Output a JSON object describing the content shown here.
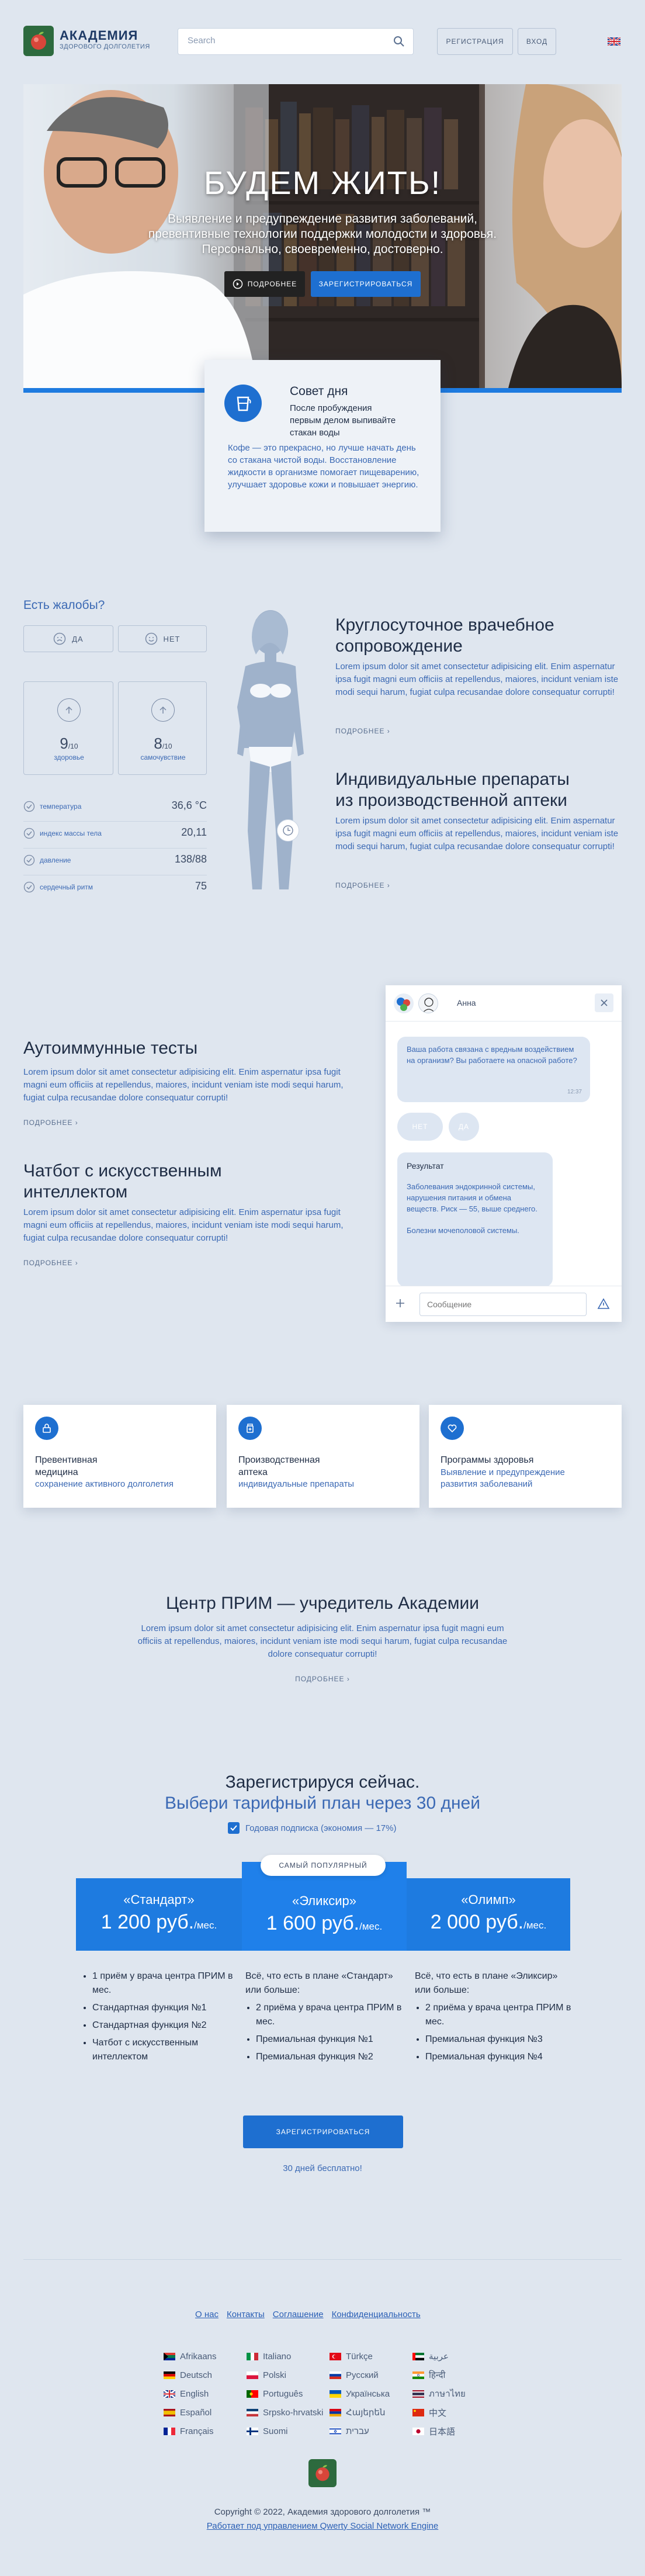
{
  "header": {
    "logo_title": "АКАДЕМИЯ",
    "logo_sub": "ЗДОРОВОГО ДОЛГОЛЕТИЯ",
    "search_placeholder": "Search",
    "register_label": "РЕГИСТРАЦИЯ",
    "login_label": "ВХОД"
  },
  "hero": {
    "title": "БУДЕМ ЖИТЬ!",
    "subtitle_1": "Выявление и предупреждение развития заболеваний,",
    "subtitle_2": "превентивные технологии поддержки молодости и здоровья.",
    "subtitle_3": "Персонально, своевременно, достоверно.",
    "more_label": "ПОДРОБНЕЕ",
    "register_label": "ЗАРЕГИСТРИРОВАТЬСЯ"
  },
  "tip": {
    "title": "Совет дня",
    "lead": "После пробуждения первым делом выпивайте стакан воды",
    "body": "Кофе — это прекрасно, но лучше начать день со стакана чистой воды. Восстановление жидкости в организме помогает пищеварению, улучшает здоровье кожи и повышает энергию."
  },
  "complaints": {
    "title": "Есть жалобы?",
    "yes": "ДА",
    "no": "НЕТ",
    "vitals_big": [
      {
        "value": "9",
        "unit": "/10",
        "label": "здоровье"
      },
      {
        "value": "8",
        "unit": "/10",
        "label": "самочувствие"
      }
    ],
    "rows": [
      {
        "label": "температура",
        "value": "36,6 °C"
      },
      {
        "label": "индекс массы тела",
        "value": "20,11"
      },
      {
        "label": "давление",
        "value": "138/88"
      },
      {
        "label": "сердечный ритм",
        "value": "75"
      }
    ]
  },
  "services": [
    {
      "title_1": "Круглосуточное врачебное",
      "title_2": "сопровождение",
      "text": "Lorem ipsum dolor sit amet consectetur adipisicing elit. Enim aspernatur ipsa fugit magni eum officiis at repellendus, maiores, incidunt veniam iste modi sequi harum, fugiat culpa recusandae dolore consequatur corrupti!",
      "more": "ПОДРОБНЕЕ"
    },
    {
      "title_1": "Индивидуальные препараты",
      "title_2": "из производственной аптеки",
      "text": "Lorem ipsum dolor sit amet consectetur adipisicing elit. Enim aspernatur ipsa fugit magni eum officiis at repellendus, maiores, incidunt veniam iste modi sequi harum, fugiat culpa recusandae dolore consequatur corrupti!",
      "more": "ПОДРОБНЕЕ"
    },
    {
      "title_1": "Аутоиммунные тесты",
      "title_2": "",
      "text": "Lorem ipsum dolor sit amet consectetur adipisicing elit. Enim aspernatur ipsa fugit magni eum officiis at repellendus, maiores, incidunt veniam iste modi sequi harum, fugiat culpa recusandae dolore consequatur corrupti!",
      "more": "ПОДРОБНЕЕ"
    },
    {
      "title_1": "Чатбот с искусственным",
      "title_2": "интеллектом",
      "text": "Lorem ipsum dolor sit amet consectetur adipisicing elit. Enim aspernatur ipsa fugit magni eum officiis at repellendus, maiores, incidunt veniam iste modi sequi harum, fugiat culpa recusandae dolore consequatur corrupti!",
      "more": "ПОДРОБНЕЕ"
    }
  ],
  "chat": {
    "name": "Анна",
    "question": "Ваша работа связана с вредным воздействием на организм? Вы работаете на опасной работе?",
    "time": "12:37",
    "answer_no": "НЕТ",
    "answer_yes": "ДА",
    "result_title": "Результат",
    "result_text": "Заболевания эндокринной системы, нарушения питания и обмена веществ. Риск — 55, выше среднего.",
    "result_extra": "Болезни мочеполовой системы.",
    "input_placeholder": "Сообщение"
  },
  "features": [
    {
      "title_1": "Превентивная",
      "title_2": "медицина",
      "sub_1": "сохранение активного долголетия",
      "sub_2": ""
    },
    {
      "title_1": "Производственная",
      "title_2": "аптека",
      "sub_1": "индивидуальные препараты",
      "sub_2": ""
    },
    {
      "title_1": "Программы здоровья",
      "title_2": "",
      "sub_1": "Выявление и предупреждение",
      "sub_2": "развития заболеваний"
    }
  ],
  "center": {
    "title": "Центр ПРИМ — учредитель Академии",
    "text": "Lorem ipsum dolor sit amet consectetur adipisicing elit. Enim aspernatur ipsa fugit magni eum officiis at repellendus, maiores, incidunt veniam iste modi sequi harum, fugiat culpa recusandae dolore consequatur corrupti!",
    "more": "ПОДРОБНЕЕ"
  },
  "pricing": {
    "title_1": "Зарегистрируся сейчас.",
    "title_2": "Выбери тарифный план через 30 дней",
    "annual_label": "Годовая подписка (экономия — 17%)",
    "popular_label": "САМЫЙ ПОПУЛЯРНЫЙ",
    "plans": [
      {
        "name": "«Стандарт»",
        "price": "1 200 руб.",
        "per": "/мес."
      },
      {
        "name": "«Эликсир»",
        "price": "1 600 руб.",
        "per": "/мес."
      },
      {
        "name": "«Олимп»",
        "price": "2 000 руб.",
        "per": "/мес."
      }
    ],
    "col1": [
      "1 приём у врача центра ПРИМ в мес.",
      "Стандартная функция №1",
      "Стандартная функция №2",
      "Чатбот с искусственным интеллектом"
    ],
    "col2_intro": "Всё, что есть в плане «Стандарт» или больше:",
    "col2": [
      "2 приёма у врача центра ПРИМ в мес.",
      "Премиальная функция №1",
      "Премиальная функция №2"
    ],
    "col3_intro": "Всё, что есть в плане «Эликсир» или больше:",
    "col3": [
      "2 приёма у врача центра ПРИМ в мес.",
      "Премиальная функция №3",
      "Премиальная функция №4"
    ],
    "register_label": "ЗАРЕГИСТРИРОВАТЬСЯ",
    "free_label": "30 дней бесплатно!"
  },
  "footer": {
    "links": [
      "О нас",
      "Контакты",
      "Соглашение",
      "Конфиденциальность"
    ],
    "languages": [
      [
        "Afrikaans",
        "Italiano",
        "Türkçe",
        "عربية"
      ],
      [
        "Deutsch",
        "Polski",
        "Русский",
        "हिन्दी"
      ],
      [
        "English",
        "Português",
        "Українська",
        "ภาษาไทย"
      ],
      [
        "Español",
        "Srpsko-hrvatski",
        "Հայերեն",
        "中文"
      ],
      [
        "Français",
        "Suomi",
        "עברית",
        "日本語"
      ]
    ],
    "copyright": "Copyright © 2022, Академия здорового долголетия ™",
    "engine": "Работает под управлением Qwerty Social Network Engine"
  }
}
